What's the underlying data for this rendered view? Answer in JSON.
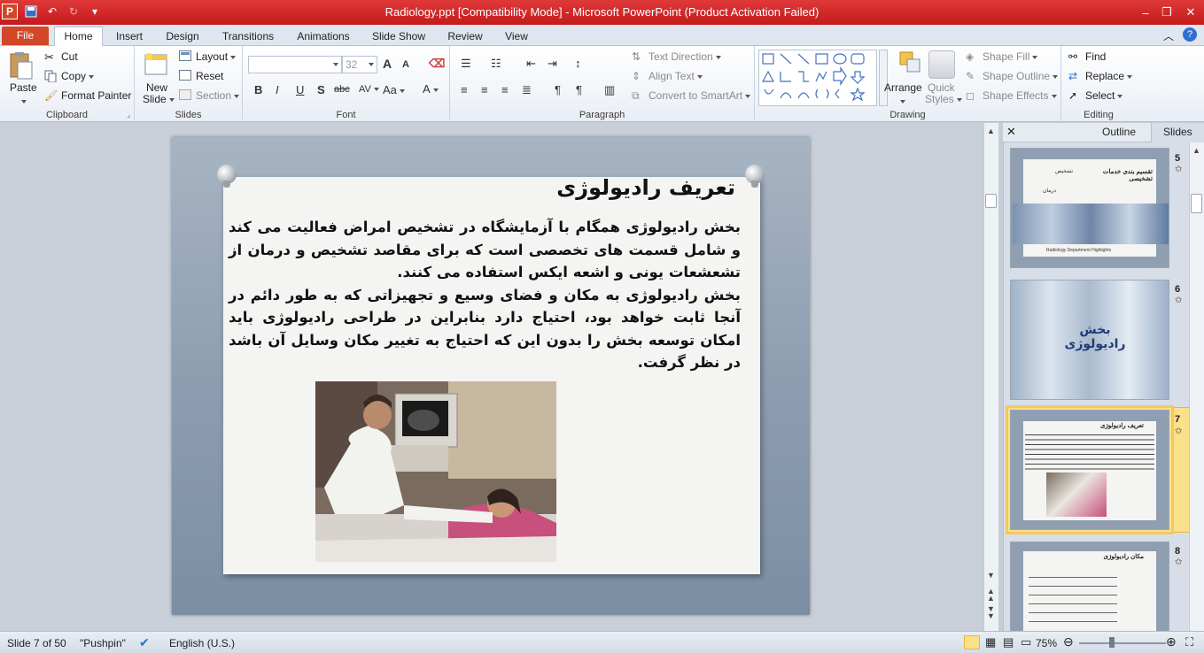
{
  "window": {
    "title": "Radiology.ppt [Compatibility Mode]  -  Microsoft PowerPoint (Product Activation Failed)",
    "app_icon": "P"
  },
  "tabs": [
    "File",
    "Home",
    "Insert",
    "Design",
    "Transitions",
    "Animations",
    "Slide Show",
    "Review",
    "View"
  ],
  "ribbon": {
    "clipboard": {
      "paste": "Paste",
      "cut": "Cut",
      "copy": "Copy",
      "format_painter": "Format Painter",
      "label": "Clipboard"
    },
    "slides": {
      "new_slide_line1": "New",
      "new_slide_line2": "Slide",
      "layout": "Layout",
      "reset": "Reset",
      "section": "Section",
      "label": "Slides"
    },
    "font": {
      "size": "32",
      "label": "Font",
      "bold": "B",
      "italic": "I",
      "underline": "U",
      "shadow": "S",
      "strike": "abc",
      "spacing": "AV",
      "case": "Aa",
      "color": "A",
      "grow": "A",
      "shrink": "A"
    },
    "paragraph": {
      "text_direction": "Text Direction",
      "align_text": "Align Text",
      "convert_smartart": "Convert to SmartArt",
      "label": "Paragraph"
    },
    "drawing": {
      "arrange": "Arrange",
      "quick_styles_line1": "Quick",
      "quick_styles_line2": "Styles",
      "shape_fill": "Shape Fill",
      "shape_outline": "Shape Outline",
      "shape_effects": "Shape Effects",
      "label": "Drawing"
    },
    "editing": {
      "find": "Find",
      "replace": "Replace",
      "select": "Select",
      "label": "Editing"
    }
  },
  "slide": {
    "title": "تعریف رادیولوژی",
    "paragraphs": [
      "بخش رادیولوژی همگام با آزمایشگاه در تشخیص امراض فعالیت می کند و شامل قسمت های تخصصی است که برای مقاصد تشخیص و درمان از تشعشعات یونی و اشعه ایکس استفاده می کنند.",
      "بخش رادیولوژی به مکان و فضای وسیع و تجهیزاتی که به طور دائم در آنجا ثابت خواهد بود، احتیاج دارد بنابراین در طراحی رادیولوژی باید امکان توسعه بخش را بدون این که احتیاج به تغییر مکان وسایل آن باشد در نظر گرفت."
    ]
  },
  "pane": {
    "tabs": [
      "Outline",
      "Slides"
    ],
    "thumbs": [
      {
        "num": "5",
        "title": "تقسیم بندی خدمات تشخیصی",
        "item1": "تشخیص",
        "item2": "درمان",
        "caption": "Radiology Department Highlights"
      },
      {
        "num": "6",
        "title": "بخش رادیولوژی"
      },
      {
        "num": "7",
        "title": "تعریف رادیولوژی",
        "selected": true
      },
      {
        "num": "8",
        "title": "مکان رادیولوژی"
      }
    ]
  },
  "status": {
    "slide_info": "Slide 7 of 50",
    "theme": "\"Pushpin\"",
    "language": "English (U.S.)",
    "zoom": "75%"
  }
}
